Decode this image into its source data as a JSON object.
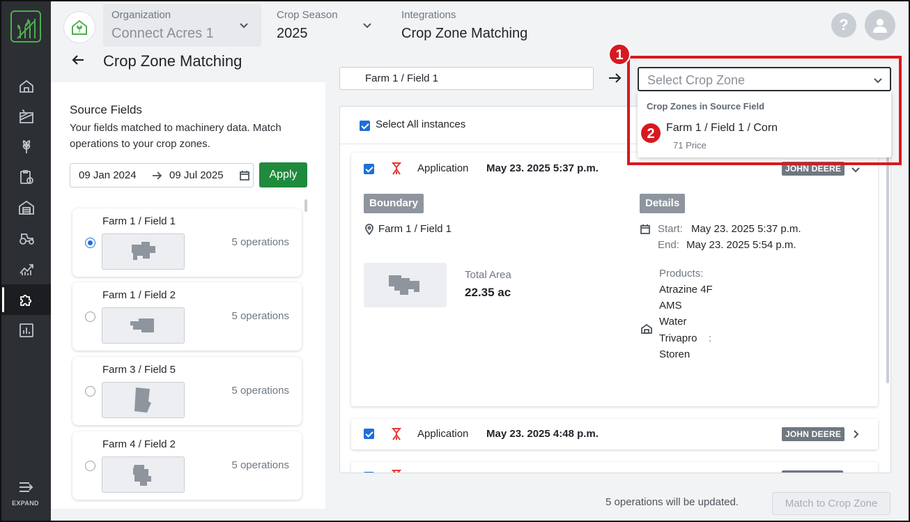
{
  "header": {
    "organization_label": "Organization",
    "organization_value": "Connect Acres 1",
    "season_label": "Crop Season",
    "season_value": "2025",
    "integrations_label": "Integrations",
    "integrations_value": "Crop Zone Matching",
    "help_label": "?"
  },
  "sidebar": {
    "expand_label": "EXPAND",
    "items": [
      "home-icon",
      "fields-icon",
      "crop-icon",
      "tasks-icon",
      "warehouse-icon",
      "tractor-icon",
      "analytics-icon",
      "integrations-icon",
      "reports-icon"
    ],
    "active": "integrations-icon"
  },
  "page": {
    "title": "Crop Zone Matching"
  },
  "source": {
    "title": "Source Fields",
    "description": "Your fields matched to machinery data. Match operations to your crop zones.",
    "date_from": "09 Jan 2024",
    "date_to": "09 Jul 2025",
    "apply_label": "Apply",
    "fields": [
      {
        "name": "Farm 1 / Field 1",
        "operations": "5 operations",
        "selected": true
      },
      {
        "name": "Farm 1 / Field 2",
        "operations": "5 operations",
        "selected": false
      },
      {
        "name": "Farm 3 / Field 5",
        "operations": "5 operations",
        "selected": false
      },
      {
        "name": "Farm 4 / Field 2",
        "operations": "5 operations",
        "selected": false
      }
    ]
  },
  "match": {
    "source_field": "Farm 1 / Field 1",
    "crop_zone_placeholder": "Select Crop Zone",
    "dropdown_header": "Crop Zones in Source Field",
    "dropdown_item": "Farm 1 / Field 1 / Corn",
    "dropdown_item_sub": "71 Price"
  },
  "operations": {
    "select_all_label": "Select All instances",
    "items": [
      {
        "type": "Application",
        "date": "May 23. 2025 5:37 p.m.",
        "provider": "JOHN DEERE",
        "boundary_label": "Boundary",
        "boundary_field": "Farm 1 / Field 1",
        "total_area_label": "Total Area",
        "total_area_value": "22.35 ac",
        "details_label": "Details",
        "start_label": "Start:",
        "start_value": "May 23. 2025 5:37 p.m.",
        "end_label": "End:",
        "end_value": "May 23. 2025 5:54 p.m.",
        "products_label": "Products:",
        "products": [
          "Atrazine 4F",
          "AMS",
          "Water",
          "Trivapro",
          "Storen"
        ],
        "trivapro_suffix": ":"
      },
      {
        "type": "Application",
        "date": "May 23. 2025 4:48 p.m.",
        "provider": "JOHN DEERE"
      },
      {
        "type": "Application",
        "date": "",
        "provider": ""
      }
    ]
  },
  "footer": {
    "status_text": "5 operations will be updated.",
    "match_button": "Match to Crop Zone"
  },
  "annotations": {
    "badge_1": "1",
    "badge_2": "2"
  },
  "colors": {
    "accent_green": "#1f8a3c",
    "highlight_red": "#d71920",
    "checkbox_blue": "#1e6fd9",
    "sidebar": "#2c2f33"
  }
}
